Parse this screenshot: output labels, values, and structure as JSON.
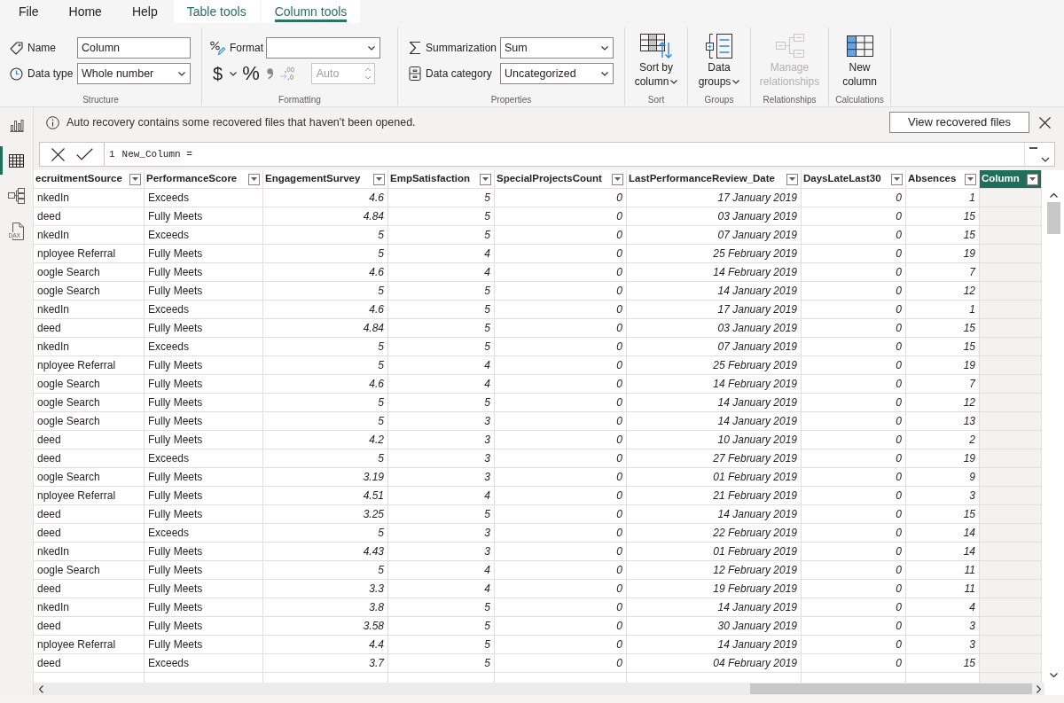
{
  "tabs": [
    {
      "label": "File",
      "contextual": false,
      "selected": false
    },
    {
      "label": "Home",
      "contextual": false,
      "selected": false
    },
    {
      "label": "Help",
      "contextual": false,
      "selected": false
    },
    {
      "label": "Table tools",
      "contextual": true,
      "selected": false
    },
    {
      "label": "Column tools",
      "contextual": true,
      "selected": true
    }
  ],
  "ribbon": {
    "structure": {
      "title": "Structure",
      "name": {
        "label": "Name",
        "value": "Column"
      },
      "data_type": {
        "label": "Data type",
        "value": "Whole number"
      }
    },
    "formatting": {
      "title": "Formatting",
      "format": {
        "label": "Format"
      },
      "currency": "$",
      "percent": "%",
      "decimal_places": {
        "value": "Auto",
        "disabled": true
      }
    },
    "properties": {
      "title": "Properties",
      "summarization": {
        "label": "Summarization",
        "value": "Sum"
      },
      "data_category": {
        "label": "Data category",
        "value": "Uncategorized"
      }
    },
    "commands": [
      {
        "title": "Sort",
        "kind": "sort",
        "lines": [
          "Sort by",
          "column"
        ],
        "dropdown": true,
        "disabled": false
      },
      {
        "title": "Groups",
        "kind": "data_groups",
        "lines": [
          "Data",
          "groups"
        ],
        "dropdown": true,
        "disabled": false
      },
      {
        "title": "Relationships",
        "kind": "relationships",
        "lines": [
          "Manage",
          "relationships"
        ],
        "dropdown": false,
        "disabled": true
      },
      {
        "title": "Calculations",
        "kind": "new_column",
        "lines": [
          "New",
          "column"
        ],
        "dropdown": false,
        "disabled": false
      }
    ]
  },
  "views": [
    {
      "kind": "report",
      "selected": false
    },
    {
      "kind": "table",
      "selected": true
    },
    {
      "kind": "model",
      "selected": false
    },
    {
      "kind": "dax",
      "selected": false,
      "badge": "DAX"
    }
  ],
  "notification": {
    "message": "Auto recovery contains some recovered files that haven't been opened.",
    "action": "View recovered files"
  },
  "formula_bar": {
    "line_number": "1",
    "formula": "New_Column ="
  },
  "table": {
    "columns": [
      {
        "label": "ecruitmentSource",
        "kind": "text",
        "selected": false
      },
      {
        "label": "PerformanceScore",
        "kind": "text",
        "selected": false
      },
      {
        "label": "EngagementSurvey",
        "kind": "number",
        "selected": false
      },
      {
        "label": "EmpSatisfaction",
        "kind": "number",
        "selected": false
      },
      {
        "label": "SpecialProjectsCount",
        "kind": "number",
        "selected": false
      },
      {
        "label": "LastPerformanceReview_Date",
        "kind": "number",
        "selected": false
      },
      {
        "label": "DaysLateLast30",
        "kind": "number",
        "selected": false
      },
      {
        "label": "Absences",
        "kind": "number",
        "selected": false
      },
      {
        "label": "Column",
        "selected": true
      }
    ],
    "rows": [
      [
        "nkedIn",
        "Exceeds",
        "4.6",
        "5",
        "0",
        "17 January 2019",
        "0",
        "1"
      ],
      [
        "deed",
        "Fully Meets",
        "4.84",
        "5",
        "0",
        "03 January 2019",
        "0",
        "15"
      ],
      [
        "nkedIn",
        "Exceeds",
        "5",
        "5",
        "0",
        "07 January 2019",
        "0",
        "15"
      ],
      [
        "nployee Referral",
        "Fully Meets",
        "5",
        "4",
        "0",
        "25 February 2019",
        "0",
        "19"
      ],
      [
        "oogle Search",
        "Fully Meets",
        "4.6",
        "4",
        "0",
        "14 February 2019",
        "0",
        "7"
      ],
      [
        "oogle Search",
        "Fully Meets",
        "5",
        "5",
        "0",
        "14 January 2019",
        "0",
        "12"
      ],
      [
        "nkedIn",
        "Exceeds",
        "4.6",
        "5",
        "0",
        "17 January 2019",
        "0",
        "1"
      ],
      [
        "deed",
        "Fully Meets",
        "4.84",
        "5",
        "0",
        "03 January 2019",
        "0",
        "15"
      ],
      [
        "nkedIn",
        "Exceeds",
        "5",
        "5",
        "0",
        "07 January 2019",
        "0",
        "15"
      ],
      [
        "nployee Referral",
        "Fully Meets",
        "5",
        "4",
        "0",
        "25 February 2019",
        "0",
        "19"
      ],
      [
        "oogle Search",
        "Fully Meets",
        "4.6",
        "4",
        "0",
        "14 February 2019",
        "0",
        "7"
      ],
      [
        "oogle Search",
        "Fully Meets",
        "5",
        "5",
        "0",
        "14 January 2019",
        "0",
        "12"
      ],
      [
        "oogle Search",
        "Fully Meets",
        "5",
        "3",
        "0",
        "14 January 2019",
        "0",
        "13"
      ],
      [
        "deed",
        "Fully Meets",
        "4.2",
        "3",
        "0",
        "10 January 2019",
        "0",
        "2"
      ],
      [
        "deed",
        "Exceeds",
        "5",
        "3",
        "0",
        "27 February 2019",
        "0",
        "19"
      ],
      [
        "oogle Search",
        "Fully Meets",
        "3.19",
        "3",
        "0",
        "01 February 2019",
        "0",
        "9"
      ],
      [
        "nployee Referral",
        "Fully Meets",
        "4.51",
        "4",
        "0",
        "21 February 2019",
        "0",
        "3"
      ],
      [
        "deed",
        "Fully Meets",
        "3.25",
        "5",
        "0",
        "14 January 2019",
        "0",
        "15"
      ],
      [
        "deed",
        "Exceeds",
        "5",
        "3",
        "0",
        "22 February 2019",
        "0",
        "14"
      ],
      [
        "nkedIn",
        "Fully Meets",
        "4.43",
        "3",
        "0",
        "01 February 2019",
        "0",
        "14"
      ],
      [
        "oogle Search",
        "Fully Meets",
        "5",
        "4",
        "0",
        "12 February 2019",
        "0",
        "11"
      ],
      [
        "deed",
        "Fully Meets",
        "3.3",
        "4",
        "0",
        "19 February 2019",
        "0",
        "11"
      ],
      [
        "nkedIn",
        "Fully Meets",
        "3.8",
        "5",
        "0",
        "14 January 2019",
        "0",
        "4"
      ],
      [
        "deed",
        "Fully Meets",
        "3.58",
        "5",
        "0",
        "30 January 2019",
        "0",
        "3"
      ],
      [
        "nployee Referral",
        "Fully Meets",
        "4.4",
        "5",
        "0",
        "14 January 2019",
        "0",
        "3"
      ],
      [
        "deed",
        "Exceeds",
        "3.7",
        "5",
        "0",
        "04 February 2019",
        "0",
        "15"
      ]
    ]
  }
}
